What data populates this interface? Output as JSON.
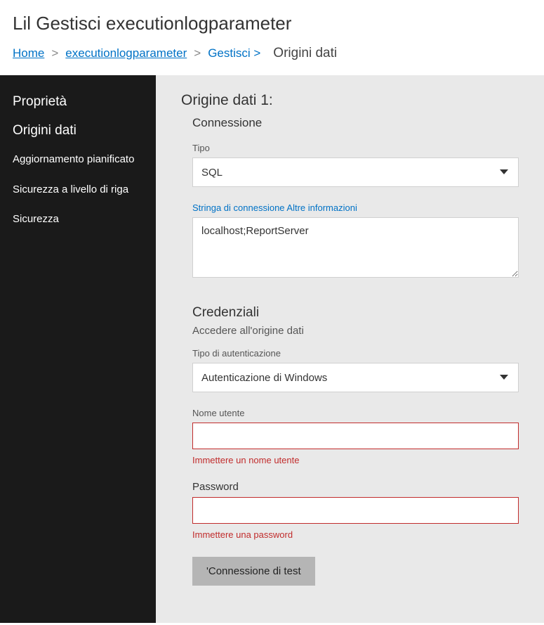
{
  "header": {
    "title": "Lil Gestisci executionlogparameter"
  },
  "breadcrumb": {
    "home": "Home",
    "item1": "executionlogparameter",
    "item2": "Gestisci >",
    "current": "Origini dati"
  },
  "sidebar": {
    "items": [
      {
        "label": "Proprietà",
        "section": true
      },
      {
        "label": "Origini dati",
        "section": true
      },
      {
        "label": "Aggiornamento pianificato",
        "section": false
      },
      {
        "label": "Sicurezza a livello di riga",
        "section": false
      },
      {
        "label": "Sicurezza",
        "section": false
      }
    ]
  },
  "main": {
    "ds_title": "Origine dati 1:",
    "connection_heading": "Connessione",
    "type_label": "Tipo",
    "type_value": "SQL",
    "connstr_label": "Stringa di connessione Altre informazioni",
    "connstr_value": "localhost;ReportServer",
    "creds_heading": "Credenziali",
    "creds_sub": "Accedere all'origine dati",
    "auth_label": "Tipo di autenticazione",
    "auth_value": "Autenticazione di Windows",
    "username_label": "Nome utente",
    "username_value": "",
    "username_error": "Immettere un nome utente",
    "password_label": "Password",
    "password_value": "",
    "password_error": "Immettere una password",
    "test_btn": "'Connessione di test"
  }
}
